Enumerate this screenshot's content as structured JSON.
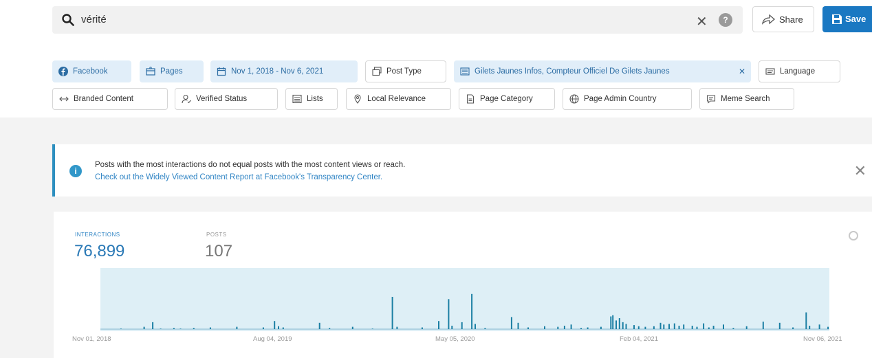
{
  "search": {
    "query": "vérité",
    "help_label": "?"
  },
  "toolbar": {
    "share_label": "Share",
    "save_label": "Save"
  },
  "filters_row1": [
    {
      "label": "Facebook",
      "icon": "facebook-icon"
    },
    {
      "label": "Pages",
      "icon": "pages-icon"
    },
    {
      "label": "Nov 1, 2018 - Nov 6, 2021",
      "icon": "calendar-icon"
    },
    {
      "label": "Post Type",
      "icon": "post-type-icon"
    },
    {
      "label": "Gilets Jaunes Infos, Compteur Officiel De Gilets Jaunes",
      "icon": "list-icon"
    },
    {
      "label": "Language",
      "icon": "language-icon"
    }
  ],
  "filters_row2": [
    {
      "label": "Branded Content",
      "icon": "branded-content-icon"
    },
    {
      "label": "Verified Status",
      "icon": "verified-icon"
    },
    {
      "label": "Lists",
      "icon": "lists-icon"
    },
    {
      "label": "Local Relevance",
      "icon": "location-pin-icon"
    },
    {
      "label": "Page Category",
      "icon": "page-category-icon"
    },
    {
      "label": "Page Admin Country",
      "icon": "globe-icon"
    },
    {
      "label": "Meme Search",
      "icon": "meme-icon"
    }
  ],
  "banner": {
    "line1": "Posts with the most interactions do not equal posts with the most content views or reach.",
    "line2": "Check out the Widely Viewed Content Report at Facebook's Transparency Center.",
    "info_glyph": "i"
  },
  "stats": {
    "interactions_label": "INTERACTIONS",
    "interactions_value": "76,899",
    "posts_label": "POSTS",
    "posts_value": "107"
  },
  "colors": {
    "accent": "#1a78c2",
    "active_chip_bg": "#e1eef9",
    "chart_bg": "#deeff6",
    "bar": "#1b7fa3"
  },
  "chart_data": {
    "type": "bar",
    "x_ticks": [
      "Nov 01, 2018",
      "Aug 04, 2019",
      "May 05, 2020",
      "Feb 04, 2021",
      "Nov 06, 2021"
    ],
    "x_range": [
      0,
      1101
    ],
    "ylim": [
      0,
      100
    ],
    "grid": false,
    "bars": [
      [
        30,
        1
      ],
      [
        65,
        4
      ],
      [
        78,
        12
      ],
      [
        90,
        1
      ],
      [
        110,
        2
      ],
      [
        120,
        1
      ],
      [
        140,
        2
      ],
      [
        165,
        3
      ],
      [
        205,
        4
      ],
      [
        245,
        3
      ],
      [
        262,
        14
      ],
      [
        268,
        5
      ],
      [
        275,
        3
      ],
      [
        330,
        11
      ],
      [
        345,
        2
      ],
      [
        380,
        4
      ],
      [
        410,
        1
      ],
      [
        440,
        56
      ],
      [
        447,
        4
      ],
      [
        485,
        3
      ],
      [
        510,
        14
      ],
      [
        525,
        52
      ],
      [
        530,
        6
      ],
      [
        545,
        12
      ],
      [
        560,
        61
      ],
      [
        565,
        9
      ],
      [
        580,
        2
      ],
      [
        620,
        21
      ],
      [
        630,
        11
      ],
      [
        645,
        3
      ],
      [
        670,
        5
      ],
      [
        690,
        4
      ],
      [
        700,
        6
      ],
      [
        710,
        8
      ],
      [
        725,
        2
      ],
      [
        735,
        3
      ],
      [
        755,
        4
      ],
      [
        770,
        22
      ],
      [
        773,
        24
      ],
      [
        778,
        15
      ],
      [
        783,
        19
      ],
      [
        788,
        12
      ],
      [
        793,
        9
      ],
      [
        805,
        7
      ],
      [
        812,
        5
      ],
      [
        822,
        4
      ],
      [
        835,
        5
      ],
      [
        845,
        11
      ],
      [
        850,
        8
      ],
      [
        858,
        9
      ],
      [
        866,
        10
      ],
      [
        873,
        6
      ],
      [
        880,
        8
      ],
      [
        893,
        6
      ],
      [
        900,
        4
      ],
      [
        910,
        10
      ],
      [
        918,
        3
      ],
      [
        925,
        6
      ],
      [
        940,
        8
      ],
      [
        955,
        2
      ],
      [
        975,
        5
      ],
      [
        1000,
        13
      ],
      [
        1025,
        11
      ],
      [
        1045,
        3
      ],
      [
        1065,
        29
      ],
      [
        1070,
        6
      ],
      [
        1085,
        8
      ],
      [
        1098,
        4
      ],
      [
        1103,
        12
      ],
      [
        1110,
        14
      ],
      [
        1117,
        7
      ],
      [
        1124,
        12
      ]
    ]
  }
}
